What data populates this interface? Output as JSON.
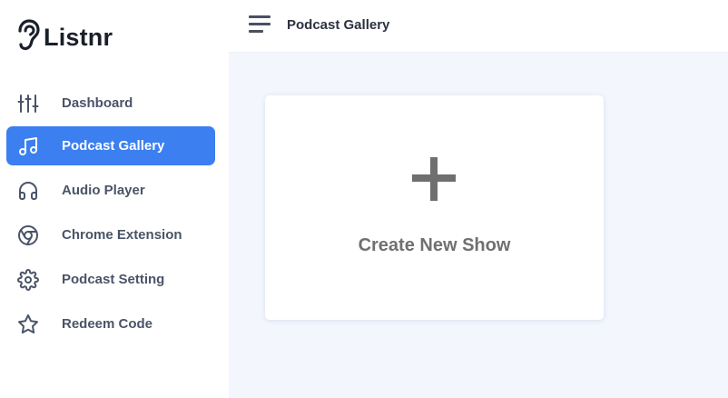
{
  "app": {
    "name": "Listnr"
  },
  "header": {
    "title": "Podcast Gallery"
  },
  "sidebar": {
    "items": [
      {
        "label": "Dashboard",
        "icon": "sliders-icon",
        "active": false
      },
      {
        "label": "Podcast Gallery",
        "icon": "music-note-icon",
        "active": true
      },
      {
        "label": "Audio Player",
        "icon": "headphones-icon",
        "active": false
      },
      {
        "label": "Chrome Extension",
        "icon": "chrome-icon",
        "active": false
      },
      {
        "label": "Podcast Setting",
        "icon": "gear-icon",
        "active": false
      },
      {
        "label": "Redeem Code",
        "icon": "star-icon",
        "active": false
      }
    ]
  },
  "main": {
    "create_card": {
      "label": "Create New Show",
      "icon": "plus-icon"
    }
  },
  "colors": {
    "accent": "#3b7ff0",
    "nav_text": "#4a5468",
    "main_bg": "#f3f6fd",
    "plus": "#6f6f6f"
  }
}
